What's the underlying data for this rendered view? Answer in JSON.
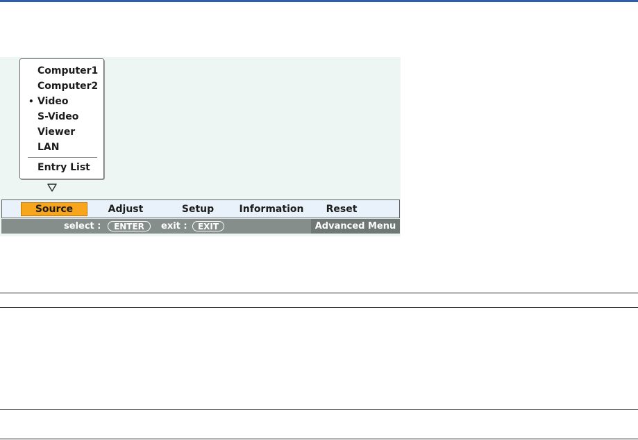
{
  "source_menu": {
    "items": [
      {
        "label": "Computer1",
        "selected": false
      },
      {
        "label": "Computer2",
        "selected": false
      },
      {
        "label": "Video",
        "selected": true
      },
      {
        "label": "S-Video",
        "selected": false
      },
      {
        "label": "Viewer",
        "selected": false
      },
      {
        "label": "LAN",
        "selected": false
      }
    ],
    "bullet": "•",
    "entry_list": "Entry List"
  },
  "menubar": {
    "tabs": [
      {
        "label": "Source",
        "active": true
      },
      {
        "label": "Adjust",
        "active": false
      },
      {
        "label": "Setup",
        "active": false
      },
      {
        "label": "Information",
        "active": false
      },
      {
        "label": "Reset",
        "active": false
      }
    ]
  },
  "statusbar": {
    "select_label": "select :",
    "enter_key": "ENTER",
    "exit_label": "exit :",
    "exit_key": "EXIT",
    "advanced_menu": "Advanced Menu"
  },
  "colors": {
    "accent_rule": "#2f5fa8",
    "active_tab": "#f7a51d",
    "osd_background": "#eef6f4",
    "status_bar": "#858e8a"
  },
  "icons": {
    "submenu_indicator": "triangle-down-outline-icon"
  }
}
